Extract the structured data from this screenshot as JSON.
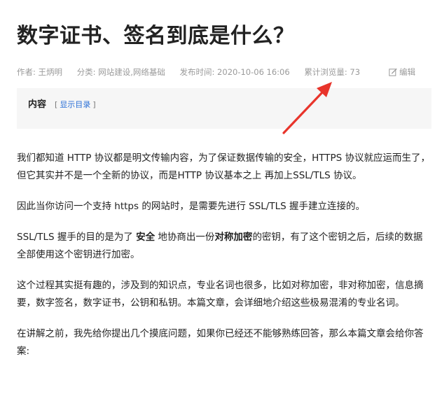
{
  "article": {
    "title": "数字证书、签名到底是什么？",
    "meta": {
      "author": "作者: 王炳明",
      "category": "分类: 网站建设,网络基础",
      "published": "发布时间: 2020-10-06 16:06",
      "views": "累计浏览量: 73",
      "edit_label": "编辑"
    },
    "toc": {
      "label": "内容",
      "bracket_open": "[",
      "link": "显示目录",
      "bracket_close": "]"
    },
    "paragraphs": {
      "p1": "我们都知道 HTTP 协议都是明文传输内容，为了保证数据传输的安全，HTTPS 协议就应运而生了，但它其实并不是一个全新的协议，而是HTTP 协议基本之上 再加上SSL/TLS 协议。",
      "p2": "因此当你访问一个支持 https 的网站时，是需要先进行 SSL/TLS 握手建立连接的。",
      "p3": {
        "part1": "SSL/TLS 握手的目的是为了 ",
        "bold1": "安全",
        "part2": " 地协商出一份",
        "bold2": "对称加密",
        "part3": "的密钥，有了这个密钥之后，后续的数据全部使用这个密钥进行加密。"
      },
      "p4": "这个过程其实挺有趣的，涉及到的知识点，专业名词也很多，比如对称加密，非对称加密，信息摘要，数字签名，数字证书，公钥和私钥。本篇文章，会详细地介绍这些极易混淆的专业名词。",
      "p5": "在讲解之前，我先给你提出几个摸底问题，如果你已经还不能够熟练回答，那么本篇文章会给你答案:"
    }
  },
  "colors": {
    "text": "#222222",
    "meta": "#9a9a9a",
    "link": "#2a6fd6",
    "toc_bg": "#f6f6f6",
    "annotation_arrow": "#e8342b"
  },
  "icons": {
    "edit": "pencil-square-icon"
  }
}
